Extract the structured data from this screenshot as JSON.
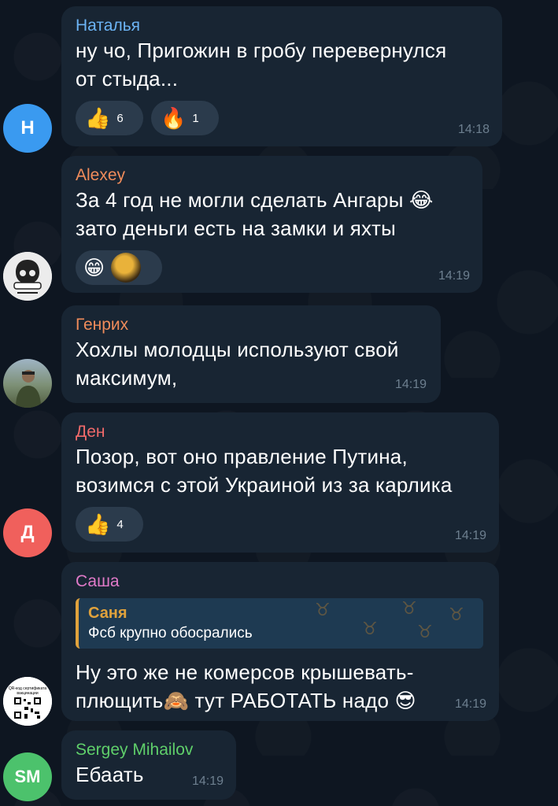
{
  "colors": {
    "background": "#0e1621",
    "bubble": "#182533",
    "reaction_bg": "#2b3b4c",
    "time": "#6d7f8f"
  },
  "messages": [
    {
      "sender": "Наталья",
      "sender_color": "#6cb4f5",
      "avatar_letter": "Н",
      "avatar_color": "#3a9af0",
      "lines": [
        "ну чо, Пригожин в гробу перевернулся",
        "от стыда..."
      ],
      "reactions": [
        {
          "emoji": "👍",
          "icon": "thumbs-up-icon",
          "count": "6"
        },
        {
          "emoji": "🔥",
          "icon": "fire-icon",
          "count": "1"
        }
      ],
      "time": "14:18"
    },
    {
      "sender": "Alexey",
      "sender_color": "#f08c5b",
      "avatar_icon": "skull-logo-avatar",
      "lines": [
        "За 4 год не могли сделать Ангары 😂",
        "зато деньги есть на замки и яхты"
      ],
      "reactions": [
        {
          "emoji": "😁",
          "icon": "grin-icon",
          "count": ""
        },
        {
          "emoji": "🌑",
          "icon": "custom-avatar-reaction-icon",
          "count": ""
        }
      ],
      "time": "14:19"
    },
    {
      "sender": "Генрих",
      "sender_color": "#f08c5b",
      "avatar_icon": "photo-avatar",
      "lines": [
        "Хохлы молодцы используют свой",
        "максимум,"
      ],
      "time": "14:19"
    },
    {
      "sender": "Ден",
      "sender_color": "#f06a6a",
      "avatar_letter": "Д",
      "avatar_color": "#f0605c",
      "lines": [
        "Позор, вот оно правление Путина,",
        "возимся с этой Украиной из за карлика"
      ],
      "reactions": [
        {
          "emoji": "👍",
          "icon": "thumbs-up-icon",
          "count": "4"
        }
      ],
      "time": "14:19"
    },
    {
      "sender": "Саша",
      "sender_color": "#e07ac8",
      "avatar_icon": "qr-code-avatar",
      "avatar_caption": "QR-код сертификата вакцинации",
      "quote": {
        "name": "Саня",
        "text": "Фсб крупно обосрались"
      },
      "lines": [
        "Ну это же не комерсов крышевать-",
        "плющить🙈 тут РАБОТАТЬ надо 😎"
      ],
      "time": "14:19"
    },
    {
      "sender": "Sergey Mihailov",
      "sender_color": "#5fcf6a",
      "avatar_letter": "SM",
      "avatar_color": "#4cc26c",
      "lines": [
        "Ебаать"
      ],
      "time": "14:19"
    }
  ]
}
